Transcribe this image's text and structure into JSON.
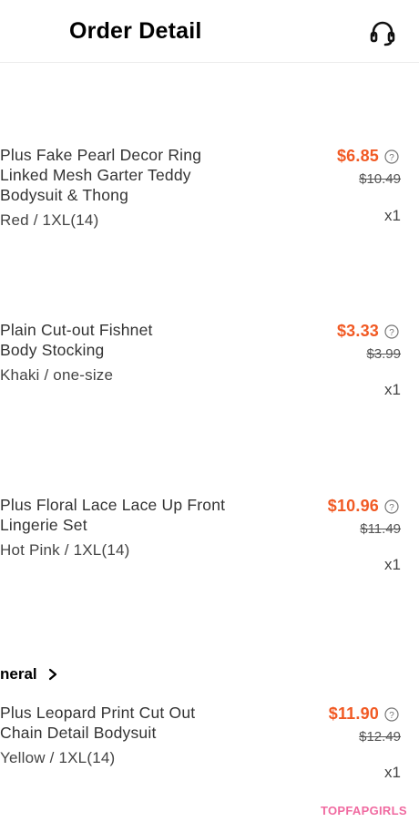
{
  "header": {
    "title": "Order Detail",
    "support_icon": "headset-icon"
  },
  "items": [
    {
      "name_lines": [
        "Plus Fake Pearl Decor Ring",
        "Linked Mesh Garter Teddy",
        "Bodysuit & Thong"
      ],
      "variant": "Red / 1XL(14)",
      "price": "$6.85",
      "original_price": "$10.49",
      "quantity": "x1"
    },
    {
      "name_lines": [
        "Plain Cut-out Fishnet",
        "Body Stocking"
      ],
      "variant": "Khaki / one-size",
      "price": "$3.33",
      "original_price": "$3.99",
      "quantity": "x1"
    },
    {
      "name_lines": [
        "Plus Floral Lace Lace Up Front",
        "Lingerie Set"
      ],
      "variant": "Hot Pink / 1XL(14)",
      "price": "$10.96",
      "original_price": "$11.49",
      "quantity": "x1"
    },
    {
      "name_lines": [
        "Plus Leopard Print Cut Out",
        "Chain Detail Bodysuit"
      ],
      "variant": "Yellow / 1XL(14)",
      "price": "$11.90",
      "original_price": "$12.49",
      "quantity": "x1"
    }
  ],
  "store": {
    "name": "neral"
  },
  "watermark": "TOPFAPGIRLS",
  "colors": {
    "price": "#f15a24",
    "watermark": "#f06aa0"
  }
}
